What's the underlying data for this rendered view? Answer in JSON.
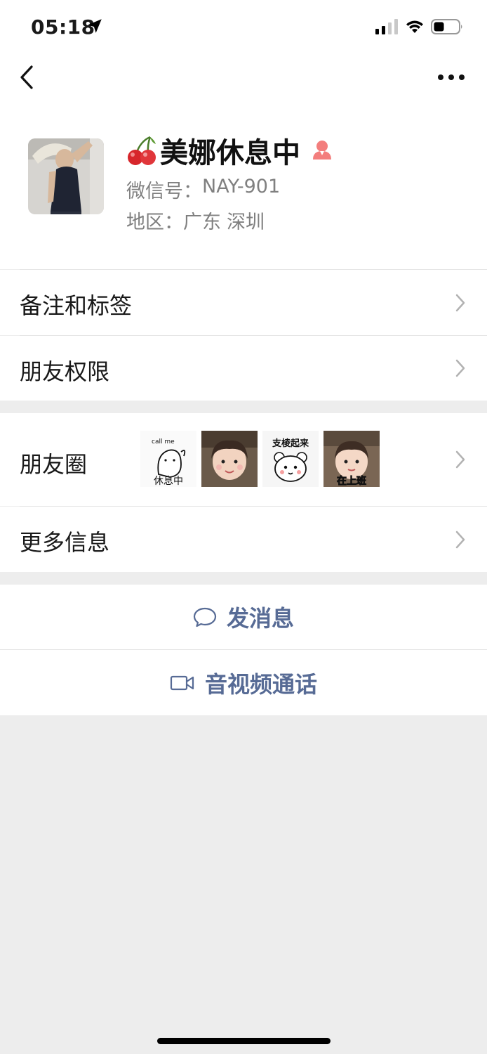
{
  "status": {
    "time": "05:18"
  },
  "profile": {
    "name": "美娜休息中",
    "wechat_id_label": "微信号：",
    "wechat_id": "NAY-901",
    "region_label": "地区：",
    "region_province": "广东",
    "region_city": "深圳"
  },
  "rows": {
    "remarks_tags": "备注和标签",
    "friend_permissions": "朋友权限",
    "moments": "朋友圈",
    "more_info": "更多信息"
  },
  "moments_thumbs": [
    {
      "caption": "休息中",
      "top_text": "call me"
    },
    {
      "caption": ""
    },
    {
      "caption": "",
      "top_text": "支棱起来"
    },
    {
      "caption": "在上班"
    }
  ],
  "actions": {
    "send_message": "发消息",
    "video_call": "音视频通话"
  },
  "colors": {
    "link_blue": "#576b95",
    "background_gray": "#ededed",
    "gender_female": "#f37e7d"
  }
}
